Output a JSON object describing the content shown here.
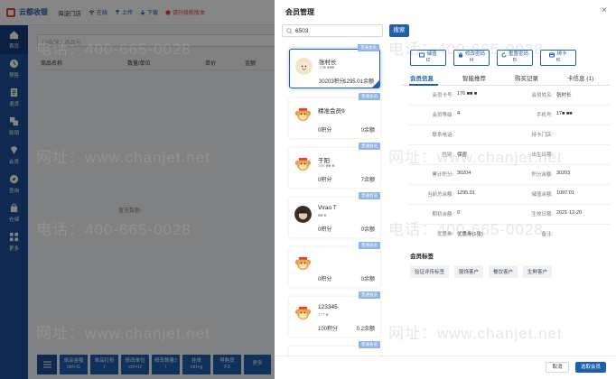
{
  "app": {
    "brand": "云都收银",
    "store": "海淀门店",
    "status_chips": [
      "在线",
      "上传",
      "下载",
      "请升级新版本"
    ],
    "search_placeholder": "扫描/输入商品号",
    "table_headers": [
      "商品名称",
      "数量/单位",
      "单价",
      "金额"
    ],
    "empty_text": "暂无数据~",
    "nav": [
      "首页",
      "预售",
      "退货",
      "赊销",
      "会员",
      "查询",
      "仓储",
      "更多"
    ],
    "function_buttons": [
      {
        "label": "单品金额",
        "key": "ctrl+G"
      },
      {
        "label": "单品打折",
        "key": "/"
      },
      {
        "label": "修改单位",
        "key": "ctrl+U"
      },
      {
        "label": "修改数量2",
        "key": "\\"
      },
      {
        "label": "挂单",
        "key": "ctrl+g"
      },
      {
        "label": "导购员",
        "key": "F3"
      },
      {
        "label": "更多",
        "key": ""
      }
    ]
  },
  "modal": {
    "title": "会员管理",
    "close": "×",
    "search_value": "6503",
    "search_button": "搜索",
    "members": [
      {
        "tag": "普通会员",
        "name": "张村长",
        "phone": "17■ ■■■",
        "points": "30203积分",
        "balance": "1295.01余额"
      },
      {
        "tag": "普通会员",
        "name": "精准会员9",
        "phone": "",
        "points": "0积分",
        "balance": "0余额"
      },
      {
        "tag": "普通会员",
        "name": "于阳",
        "phone": "168 ■■ ■",
        "points": "0积分",
        "balance": "7余额"
      },
      {
        "tag": "普通会员",
        "name": "Virao T",
        "phone": "■■ ■",
        "points": "0积分",
        "balance": "0余额"
      },
      {
        "tag": "普通会员",
        "name": "",
        "phone": "",
        "points": "0积分",
        "balance": "0余额"
      },
      {
        "tag": "普通会员",
        "name": "123345",
        "phone": "177 ■",
        "points": "100积分",
        "balance": "0.2余额"
      },
      {
        "tag": "普通会员",
        "name": "",
        "phone": "",
        "points": "",
        "balance": ""
      }
    ],
    "actions": [
      {
        "label": "储值",
        "key": "f2"
      },
      {
        "label": "修改密码",
        "key": "f4"
      },
      {
        "label": "重置密码",
        "key": "f5"
      },
      {
        "label": "绑卡",
        "key": "f6"
      }
    ],
    "tabs": [
      "会员信息",
      "智能推荐",
      "购买记录",
      "卡信息 (1)"
    ],
    "info": [
      {
        "left_label": "会员卡号:",
        "left_value": "176 ■■ ■",
        "right_label": "会员姓名:",
        "right_value": "张村长"
      },
      {
        "left_label": "会员等级:",
        "left_value": "4",
        "right_label": "手机号:",
        "right_value": "17■  ■■"
      },
      {
        "left_label": "联系电话:",
        "left_value": "",
        "right_label": "持卡门店:",
        "right_value": ""
      },
      {
        "left_label": "性别:",
        "left_value": "保密",
        "right_label": "出生日期:",
        "right_value": ""
      },
      {
        "left_label": "累计积分:",
        "left_value": "30204",
        "right_label": "积分余额:",
        "right_value": "30203"
      },
      {
        "left_label": "当前总余额:",
        "left_value": "1295.01",
        "right_label": "储值余额:",
        "right_value": "1097.01"
      },
      {
        "left_label": "期初余额:",
        "left_value": "0",
        "right_label": "生效日期:",
        "right_value": "2021-12-20"
      },
      {
        "left_label": "优惠券:",
        "left_value": "优惠券(1张)",
        "right_label": "备注:",
        "right_value": ""
      }
    ],
    "labels_title": "会员标签",
    "labels": [
      "验证评传标签",
      "服饰客户",
      "餐饮客户",
      "生鲜客户"
    ],
    "cancel": "取消",
    "confirm": "选取会员"
  },
  "watermarks": [
    "电话：400-665-0028",
    "网址：www.chanjet.net"
  ],
  "colors": {
    "primary": "#1f5fb0",
    "nav": "#1f4f9a",
    "alert": "#e0463a"
  }
}
